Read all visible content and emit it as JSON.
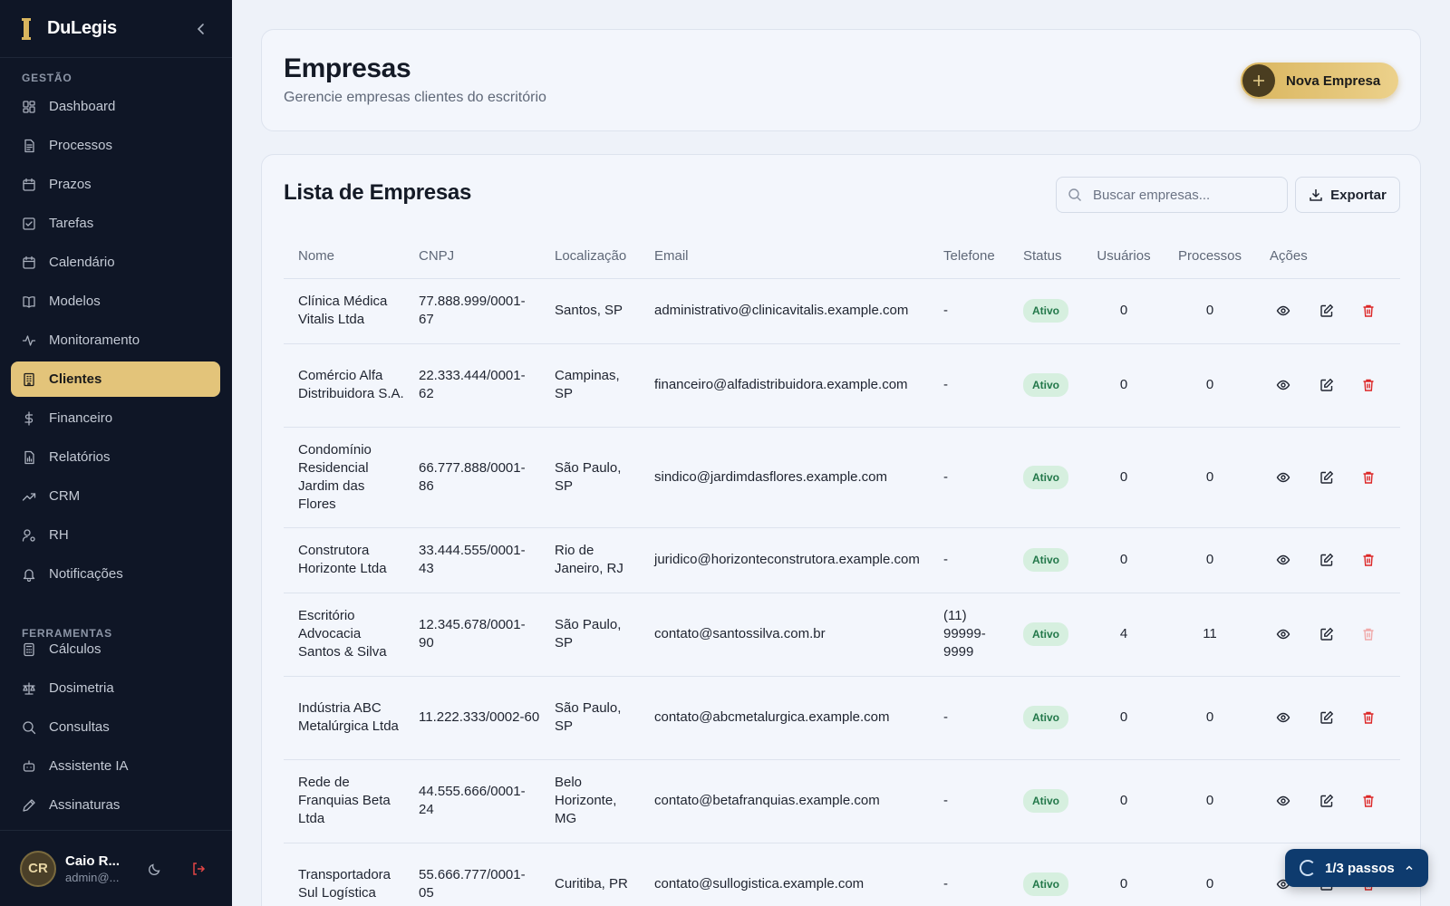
{
  "app": {
    "name": "DuLegis"
  },
  "sidebar": {
    "sections": [
      {
        "label": "GESTÃO"
      },
      {
        "label": "FERRAMENTAS"
      }
    ],
    "items": [
      {
        "label": "Dashboard",
        "icon": "dashboard-icon"
      },
      {
        "label": "Processos",
        "icon": "document-icon"
      },
      {
        "label": "Prazos",
        "icon": "calendar-icon"
      },
      {
        "label": "Tarefas",
        "icon": "checkbox-icon"
      },
      {
        "label": "Calendário",
        "icon": "calendar-icon"
      },
      {
        "label": "Modelos",
        "icon": "book-icon"
      },
      {
        "label": "Monitoramento",
        "icon": "activity-icon"
      },
      {
        "label": "Clientes",
        "icon": "building-icon",
        "active": true
      },
      {
        "label": "Financeiro",
        "icon": "dollar-icon"
      },
      {
        "label": "Relatórios",
        "icon": "report-icon"
      },
      {
        "label": "CRM",
        "icon": "trending-up-icon"
      },
      {
        "label": "RH",
        "icon": "user-cog-icon"
      },
      {
        "label": "Notificações",
        "icon": "bell-icon"
      },
      {
        "label": "Cálculos",
        "icon": "calculator-icon"
      },
      {
        "label": "Dosimetria",
        "icon": "scale-icon"
      },
      {
        "label": "Consultas",
        "icon": "search-icon"
      },
      {
        "label": "Assistente IA",
        "icon": "bot-icon"
      },
      {
        "label": "Assinaturas",
        "icon": "pen-icon"
      }
    ],
    "user": {
      "initials": "CR",
      "name": "Caio R...",
      "email": "admin@..."
    }
  },
  "header": {
    "title": "Empresas",
    "subtitle": "Gerencie empresas clientes do escritório",
    "new_button": "Nova Empresa"
  },
  "list": {
    "title": "Lista de Empresas",
    "search_placeholder": "Buscar empresas...",
    "export_label": "Exportar",
    "columns": [
      "Nome",
      "CNPJ",
      "Localização",
      "Email",
      "Telefone",
      "Status",
      "Usuários",
      "Processos",
      "Ações"
    ],
    "rows": [
      {
        "nome": "Clínica Médica Vitalis Ltda",
        "cnpj": "77.888.999/0001-67",
        "local": "Santos, SP",
        "email": "administrativo@clinicavitalis.example.com",
        "telefone": "-",
        "status": "Ativo",
        "usuarios": "0",
        "processos": "0"
      },
      {
        "nome": "Comércio Alfa Distribuidora S.A.",
        "cnpj": "22.333.444/0001-62",
        "local": "Campinas, SP",
        "email": "financeiro@alfadistribuidora.example.com",
        "telefone": "-",
        "status": "Ativo",
        "usuarios": "0",
        "processos": "0"
      },
      {
        "nome": "Condomínio Residencial Jardim das Flores",
        "cnpj": "66.777.888/0001-86",
        "local": "São Paulo, SP",
        "email": "sindico@jardimdasflores.example.com",
        "telefone": "-",
        "status": "Ativo",
        "usuarios": "0",
        "processos": "0"
      },
      {
        "nome": "Construtora Horizonte Ltda",
        "cnpj": "33.444.555/0001-43",
        "local": "Rio de Janeiro, RJ",
        "email": "juridico@horizonteconstrutora.example.com",
        "telefone": "-",
        "status": "Ativo",
        "usuarios": "0",
        "processos": "0"
      },
      {
        "nome": "Escritório Advocacia Santos & Silva",
        "cnpj": "12.345.678/0001-90",
        "local": "São Paulo, SP",
        "email": "contato@santossilva.com.br",
        "telefone": "(11) 99999-9999",
        "status": "Ativo",
        "usuarios": "4",
        "processos": "11",
        "delete_disabled": true
      },
      {
        "nome": "Indústria ABC Metalúrgica Ltda",
        "cnpj": "11.222.333/0002-60",
        "local": "São Paulo, SP",
        "email": "contato@abcmetalurgica.example.com",
        "telefone": "-",
        "status": "Ativo",
        "usuarios": "0",
        "processos": "0"
      },
      {
        "nome": "Rede de Franquias Beta Ltda",
        "cnpj": "44.555.666/0001-24",
        "local": "Belo Horizonte, MG",
        "email": "contato@betafranquias.example.com",
        "telefone": "-",
        "status": "Ativo",
        "usuarios": "0",
        "processos": "0"
      },
      {
        "nome": "Transportadora Sul Logística",
        "cnpj": "55.666.777/0001-05",
        "local": "Curitiba, PR",
        "email": "contato@sullogistica.example.com",
        "telefone": "-",
        "status": "Ativo",
        "usuarios": "0",
        "processos": "0"
      }
    ]
  },
  "onboarding": {
    "label": "1/3 passos"
  },
  "colors": {
    "sidebar_bg": "#0f1626",
    "accent": "#e3c47a",
    "danger": "#dc2626",
    "success_bg": "#d6efdf",
    "success_text": "#23784a",
    "steps_bg": "#0e3b6e"
  }
}
